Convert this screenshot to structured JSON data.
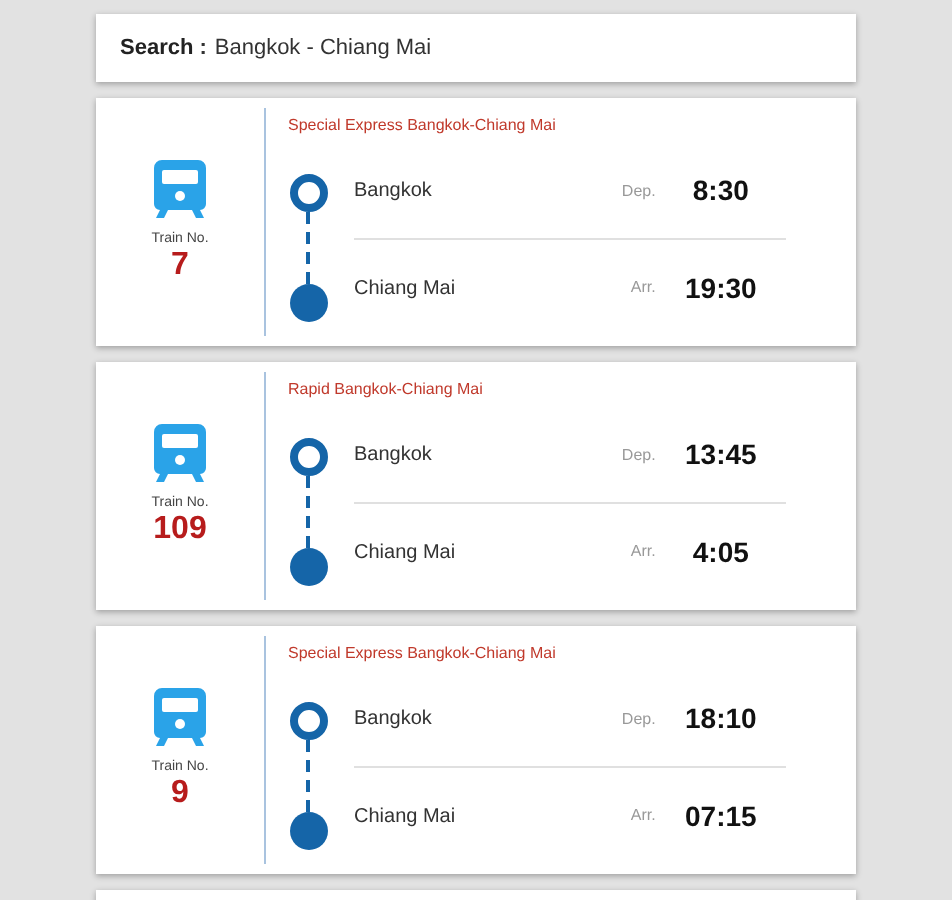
{
  "search": {
    "label": "Search",
    "separator": ":",
    "value": "Bangkok - Chiang Mai"
  },
  "trains": [
    {
      "train_label": "Train No.",
      "number": "7",
      "route": "Special Express Bangkok-Chiang Mai",
      "stops": [
        {
          "kind": "departure",
          "station": "Bangkok",
          "label": "Dep.",
          "time": "8:30"
        },
        {
          "kind": "arrival",
          "station": "Chiang Mai",
          "label": "Arr.",
          "time": "19:30"
        }
      ]
    },
    {
      "train_label": "Train No.",
      "number": "109",
      "route": "Rapid Bangkok-Chiang Mai",
      "stops": [
        {
          "kind": "departure",
          "station": "Bangkok",
          "label": "Dep.",
          "time": "13:45"
        },
        {
          "kind": "arrival",
          "station": "Chiang Mai",
          "label": "Arr.",
          "time": "4:05"
        }
      ]
    },
    {
      "train_label": "Train No.",
      "number": "9",
      "route": "Special Express Bangkok-Chiang Mai",
      "stops": [
        {
          "kind": "departure",
          "station": "Bangkok",
          "label": "Dep.",
          "time": "18:10"
        },
        {
          "kind": "arrival",
          "station": "Chiang Mai",
          "label": "Arr.",
          "time": "07:15"
        }
      ]
    }
  ]
}
